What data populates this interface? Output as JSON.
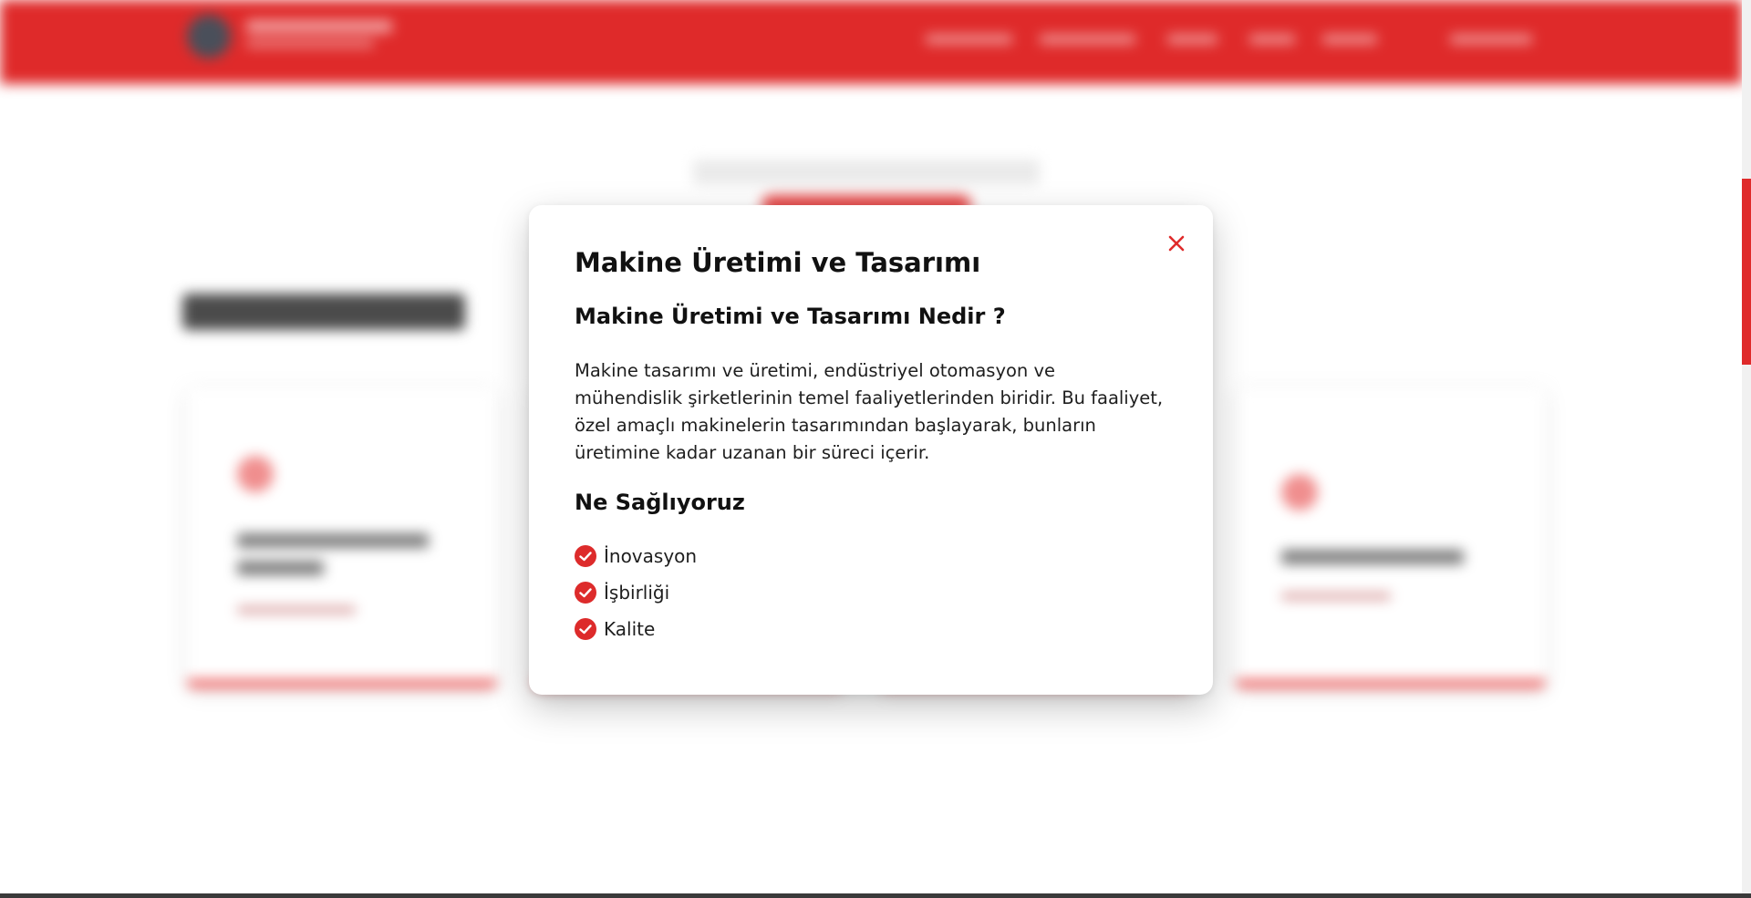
{
  "modal": {
    "title": "Makine Üretimi ve Tasarımı",
    "subtitle": "Makine Üretimi ve Tasarımı Nedir ?",
    "description_lines": [
      "Makine tasarımı ve üretimi, endüstriyel otomasyon ve",
      "mühendislik şirketlerinin temel faaliyetlerinden biridir. Bu faaliyet,",
      "özel amaçlı makinelerin tasarımından başlayarak, bunların",
      "üretimine kadar uzanan bir süreci içerir."
    ],
    "section_title": "Ne Sağlıyoruz",
    "features": [
      "İnovasyon",
      "İşbirliği",
      "Kalite"
    ],
    "close_icon": "close-icon",
    "check_icon": "check-circle-icon"
  },
  "colors": {
    "accent": "#df2a2a",
    "check": "#dd2b2b",
    "text": "#111111",
    "modal_background": "#ffffff"
  }
}
